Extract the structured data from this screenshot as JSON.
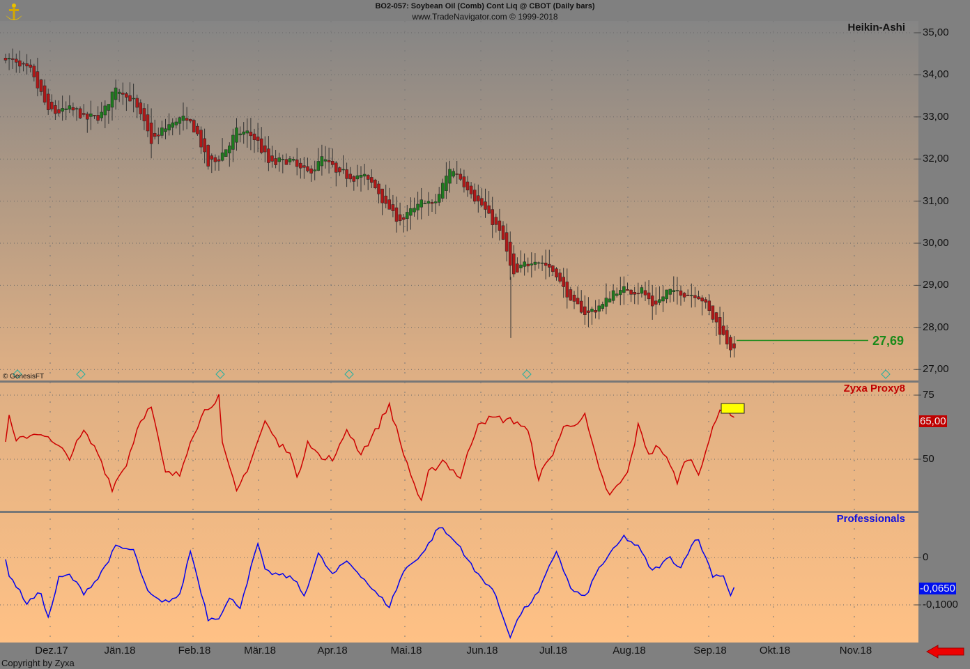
{
  "header": {
    "title": "BO2-057:  Soybean Oil (Comb) Cont Liq @ CBOT  (Daily bars)",
    "subtitle": "www.TradeNavigator.com © 1999-2018"
  },
  "footer": {
    "copyright": "Copyright by Zyxa",
    "genesis": "© GenesisFT"
  },
  "colors": {
    "up": "#1e7a1e",
    "down": "#b01818",
    "proxy": "#cc0000",
    "professionals": "#0000ee",
    "last_price": "#1a8a1a"
  },
  "chart_data": [
    {
      "type": "candlestick",
      "title": "Heikin-Ashi",
      "bars": 206,
      "ylim": [
        26.8,
        35.3
      ],
      "yticks": [
        "35,00",
        "34,00",
        "33,00",
        "32,00",
        "31,00",
        "30,00",
        "29,00",
        "28,00",
        "27,00"
      ],
      "ytick_values": [
        35,
        34,
        33,
        32,
        31,
        30,
        29,
        28,
        27
      ],
      "last_value": 27.69,
      "last_label": "27,69",
      "close_anchors": [
        [
          0,
          34.4
        ],
        [
          7,
          34.0
        ],
        [
          12,
          33.0
        ],
        [
          18,
          33.2
        ],
        [
          23,
          32.9
        ],
        [
          27,
          33.1
        ],
        [
          31,
          33.8
        ],
        [
          36,
          33.3
        ],
        [
          41,
          32.3
        ],
        [
          45,
          32.8
        ],
        [
          49,
          33.0
        ],
        [
          53,
          32.7
        ],
        [
          57,
          31.7
        ],
        [
          61,
          32.2
        ],
        [
          65,
          32.7
        ],
        [
          70,
          32.5
        ],
        [
          74,
          31.8
        ],
        [
          79,
          32.0
        ],
        [
          85,
          31.6
        ],
        [
          89,
          32.1
        ],
        [
          93,
          31.6
        ],
        [
          100,
          31.6
        ],
        [
          104,
          31.3
        ],
        [
          108,
          30.7
        ],
        [
          111,
          30.5
        ],
        [
          118,
          31.1
        ],
        [
          120,
          30.8
        ],
        [
          125,
          31.9
        ],
        [
          129,
          31.4
        ],
        [
          134,
          30.8
        ],
        [
          139,
          30.2
        ],
        [
          143,
          29.0
        ],
        [
          145,
          29.4
        ],
        [
          149,
          29.7
        ],
        [
          155,
          29.2
        ],
        [
          159,
          28.5
        ],
        [
          163,
          28.3
        ],
        [
          167,
          28.5
        ],
        [
          171,
          28.9
        ],
        [
          175,
          28.9
        ],
        [
          179,
          28.9
        ],
        [
          182,
          28.4
        ],
        [
          186,
          28.9
        ],
        [
          190,
          28.8
        ],
        [
          195,
          28.8
        ],
        [
          198,
          28.3
        ],
        [
          202,
          27.7
        ],
        [
          205,
          27.4
        ]
      ]
    },
    {
      "type": "line",
      "title": "Zyxa Proxy8",
      "ylim": [
        30,
        80
      ],
      "yticks": [
        "75",
        "50"
      ],
      "ytick_values": [
        75,
        50
      ],
      "last_label": "65,00",
      "points": [
        [
          0,
          57.9
        ],
        [
          1,
          66.0
        ],
        [
          3,
          56.5
        ],
        [
          6,
          59.2
        ],
        [
          10,
          60.6
        ],
        [
          13,
          56.5
        ],
        [
          18,
          51.1
        ],
        [
          22,
          60.6
        ],
        [
          26,
          52.4
        ],
        [
          30,
          38.9
        ],
        [
          34,
          48.4
        ],
        [
          38,
          66.0
        ],
        [
          41,
          70.1
        ],
        [
          45,
          44.3
        ],
        [
          49,
          43.8
        ],
        [
          52,
          57.9
        ],
        [
          56,
          68.8
        ],
        [
          60,
          74.7
        ],
        [
          61,
          55.2
        ],
        [
          65,
          37.0
        ],
        [
          69,
          49.7
        ],
        [
          73,
          64.7
        ],
        [
          77,
          55.2
        ],
        [
          80,
          53.8
        ],
        [
          82,
          41.6
        ],
        [
          85,
          57.9
        ],
        [
          89,
          49.7
        ],
        [
          93,
          51.1
        ],
        [
          96,
          62.0
        ],
        [
          100,
          52.4
        ],
        [
          104,
          60.6
        ],
        [
          108,
          71.5
        ],
        [
          111,
          56.5
        ],
        [
          114,
          44.3
        ],
        [
          117,
          32.6
        ],
        [
          119,
          44.3
        ],
        [
          123,
          49.7
        ],
        [
          128,
          42.9
        ],
        [
          133,
          64.7
        ],
        [
          138,
          66.0
        ],
        [
          144,
          64.7
        ],
        [
          147,
          60.6
        ],
        [
          150,
          42.9
        ],
        [
          153,
          49.7
        ],
        [
          157,
          62.0
        ],
        [
          163,
          66.6
        ],
        [
          167,
          45.6
        ],
        [
          170,
          35.6
        ],
        [
          175,
          44.3
        ],
        [
          178,
          62.8
        ],
        [
          181,
          52.4
        ],
        [
          184,
          55.2
        ],
        [
          189,
          41.6
        ],
        [
          192,
          51.1
        ],
        [
          195,
          44.8
        ],
        [
          197,
          53.8
        ],
        [
          201,
          68.8
        ],
        [
          203,
          70.9
        ],
        [
          205,
          65.0
        ]
      ]
    },
    {
      "type": "line",
      "title": "Professionals",
      "ylim": [
        -0.18,
        0.095
      ],
      "yticks": [
        "0",
        "-0,1000"
      ],
      "ytick_values": [
        0,
        -0.1
      ],
      "last_label": "-0,0650",
      "points": [
        [
          0,
          0
        ],
        [
          1,
          -0.037
        ],
        [
          6,
          -0.096
        ],
        [
          10,
          -0.074
        ],
        [
          12,
          -0.129
        ],
        [
          15,
          -0.044
        ],
        [
          18,
          -0.037
        ],
        [
          22,
          -0.074
        ],
        [
          26,
          -0.044
        ],
        [
          31,
          0.022
        ],
        [
          36,
          0.015
        ],
        [
          40,
          -0.074
        ],
        [
          44,
          -0.096
        ],
        [
          49,
          -0.081
        ],
        [
          52,
          0.015
        ],
        [
          57,
          -0.129
        ],
        [
          60,
          -0.125
        ],
        [
          63,
          -0.088
        ],
        [
          66,
          -0.103
        ],
        [
          71,
          0.029
        ],
        [
          73,
          -0.029
        ],
        [
          77,
          -0.037
        ],
        [
          81,
          -0.044
        ],
        [
          84,
          -0.081
        ],
        [
          88,
          0.007
        ],
        [
          92,
          -0.037
        ],
        [
          96,
          -0.007
        ],
        [
          100,
          -0.037
        ],
        [
          104,
          -0.074
        ],
        [
          108,
          -0.103
        ],
        [
          112,
          -0.029
        ],
        [
          118,
          0.015
        ],
        [
          122,
          0.066
        ],
        [
          128,
          0.022
        ],
        [
          132,
          -0.029
        ],
        [
          137,
          -0.066
        ],
        [
          142,
          -0.165
        ],
        [
          145,
          -0.118
        ],
        [
          150,
          -0.074
        ],
        [
          155,
          0.015
        ],
        [
          159,
          -0.066
        ],
        [
          163,
          -0.085
        ],
        [
          167,
          -0.022
        ],
        [
          171,
          0.015
        ],
        [
          174,
          0.044
        ],
        [
          178,
          0.022
        ],
        [
          182,
          -0.029
        ],
        [
          187,
          0
        ],
        [
          190,
          -0.022
        ],
        [
          193,
          0.029
        ],
        [
          195,
          0.037
        ],
        [
          199,
          -0.037
        ],
        [
          202,
          -0.037
        ],
        [
          204,
          -0.081
        ],
        [
          205,
          -0.063
        ]
      ]
    }
  ],
  "xaxis": {
    "labels": [
      "Dez.17",
      "Jän.18",
      "Feb.18",
      "Mär.18",
      "Apr.18",
      "Mai.18",
      "Jun.18",
      "Jul.18",
      "Aug.18",
      "Sep.18",
      "Okt.18",
      "Nov.18"
    ]
  }
}
